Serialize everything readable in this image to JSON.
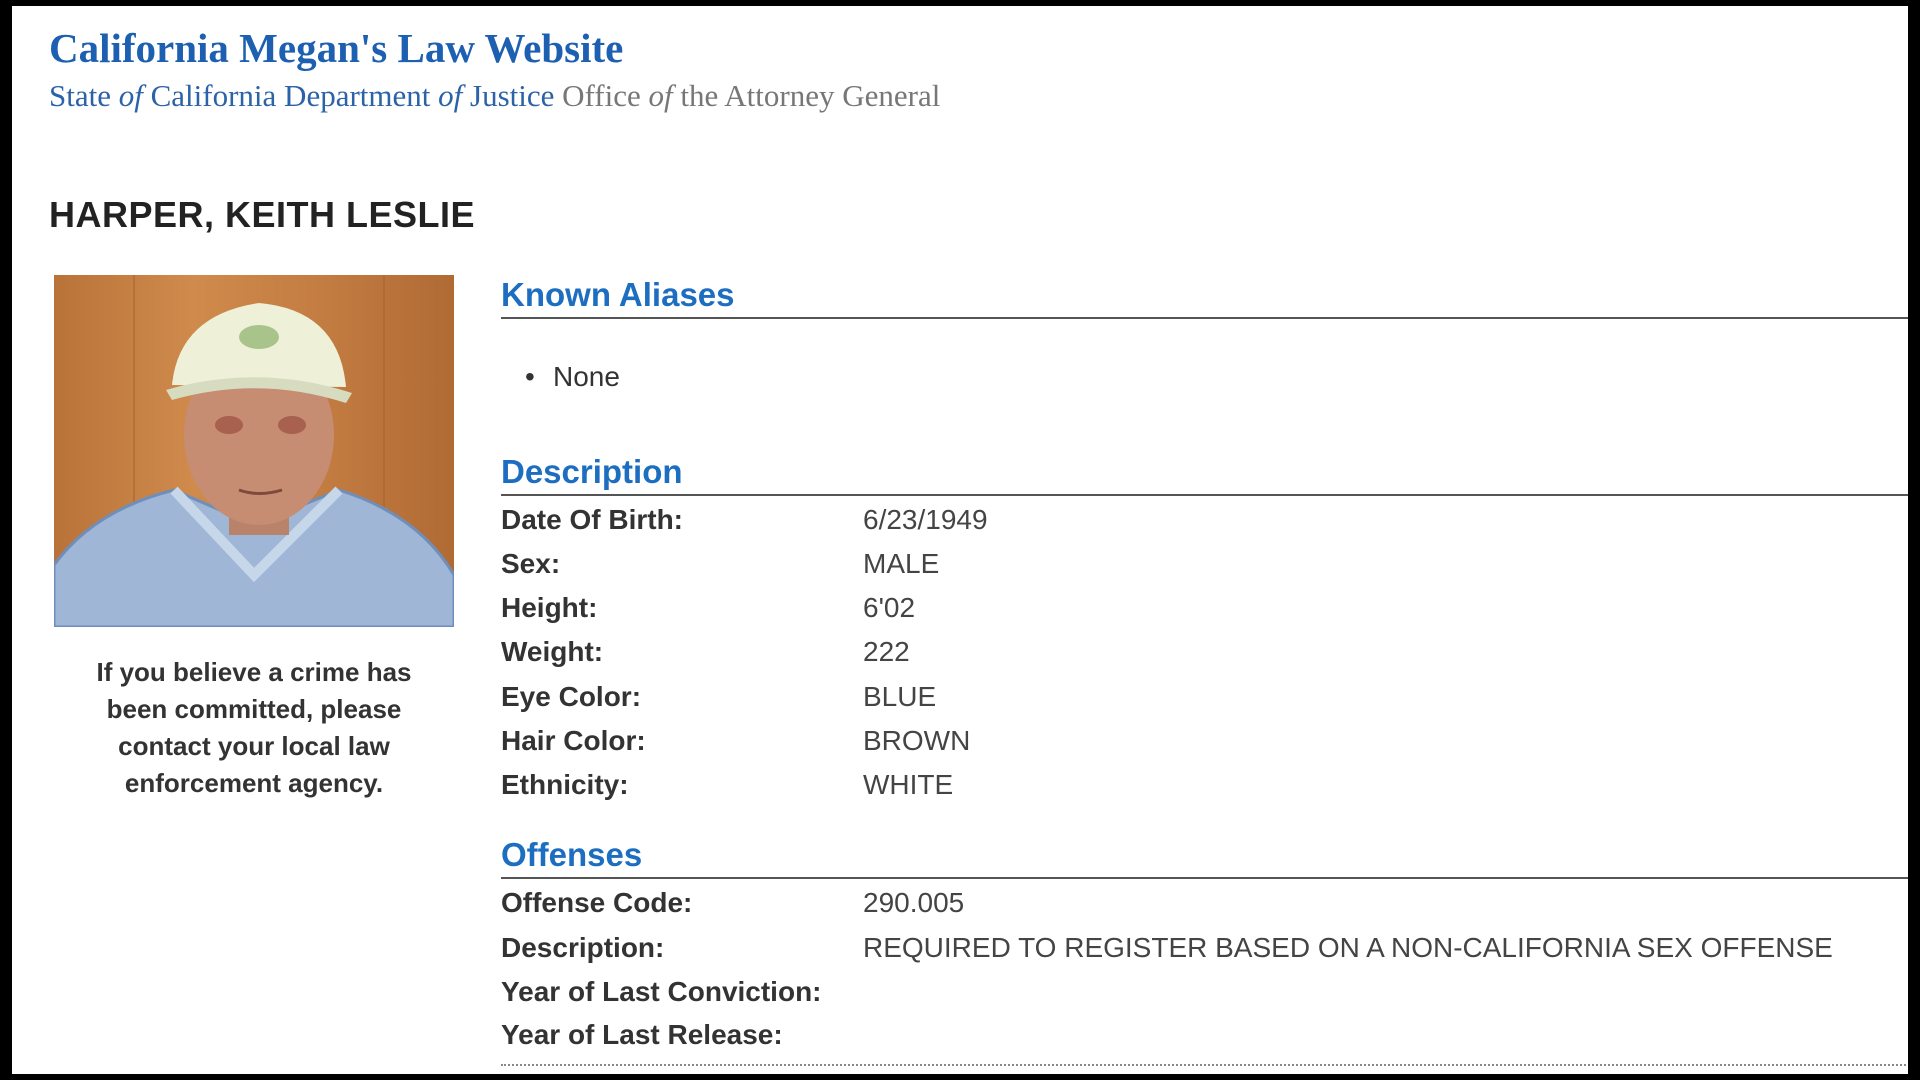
{
  "header": {
    "site_title": "California Megan's Law Website",
    "subtitle_parts": {
      "p1": "State ",
      "of1": "of",
      "p2": " California Department ",
      "of2": "of",
      "p3": " Justice ",
      "p4": "Office ",
      "of3": "of",
      "p5": " the Attorney General"
    }
  },
  "person": {
    "name": "HARPER, KEITH LESLIE",
    "photo_icon": "person-photo"
  },
  "crime_note": {
    "line1": "If you believe a crime has",
    "line2": "been committed, please",
    "line3": "contact your local law",
    "line4": "enforcement agency."
  },
  "aliases": {
    "heading": "Known Aliases",
    "items": [
      "None"
    ]
  },
  "description": {
    "heading": "Description",
    "rows": [
      {
        "label": "Date Of Birth:",
        "value": "6/23/1949"
      },
      {
        "label": "Sex:",
        "value": "MALE"
      },
      {
        "label": "Height:",
        "value": "6'02"
      },
      {
        "label": "Weight:",
        "value": "222"
      },
      {
        "label": "Eye Color:",
        "value": "BLUE"
      },
      {
        "label": "Hair Color:",
        "value": "BROWN"
      },
      {
        "label": "Ethnicity:",
        "value": "WHITE"
      }
    ]
  },
  "offenses": {
    "heading": "Offenses",
    "rows": [
      {
        "label": "Offense Code:",
        "value": "290.005"
      },
      {
        "label": "Description:",
        "value": "REQUIRED TO REGISTER BASED ON A NON-CALIFORNIA SEX OFFENSE"
      },
      {
        "label": "Year of Last Conviction:",
        "value": ""
      },
      {
        "label": "Year of Last Release:",
        "value": ""
      }
    ]
  },
  "colors": {
    "heading_blue": "#1d6ec0",
    "title_blue": "#1d5fb0",
    "frame_black": "#000000"
  }
}
